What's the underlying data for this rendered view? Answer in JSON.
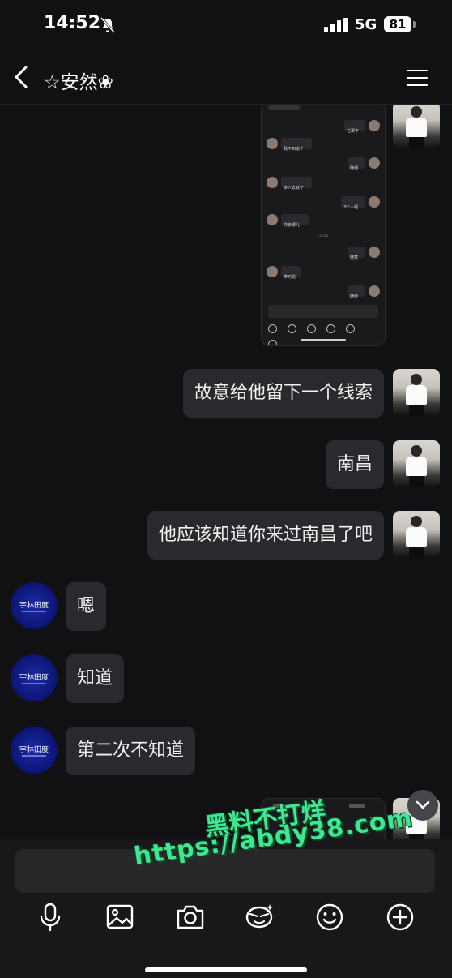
{
  "status": {
    "time": "14:52",
    "network": "5G",
    "battery": "81"
  },
  "header": {
    "title": "☆安然❀"
  },
  "messages": [
    {
      "side": "me",
      "text": "故意给他留下一个线索"
    },
    {
      "side": "me",
      "text": "南昌"
    },
    {
      "side": "me",
      "text": "他应该知道你来过南昌了吧"
    },
    {
      "side": "them",
      "text": "嗯"
    },
    {
      "side": "them",
      "text": "知道"
    },
    {
      "side": "them",
      "text": "第二次不知道"
    }
  ],
  "shared_screenshot": {
    "messages": [
      {
        "side": "me",
        "text": "在那不"
      },
      {
        "side": "them",
        "text": "我不知道个"
      },
      {
        "side": "me",
        "text": "随便"
      },
      {
        "side": "them",
        "text": "多人去就了"
      },
      {
        "side": "me",
        "text": "3个人呢"
      },
      {
        "side": "them",
        "text": "你去哪儿"
      },
      {
        "side": "me",
        "text": "随意"
      },
      {
        "side": "them",
        "text": "带时说"
      },
      {
        "side": "me",
        "text": "随便"
      }
    ],
    "time_marker": "15:32"
  },
  "them_avatar_label": "宇林田度",
  "watermark": {
    "line1": "黑料不打烊",
    "line2": "https://abdy38.com"
  },
  "icons": [
    "microphone-icon",
    "image-icon",
    "camera-icon",
    "sticker-icon",
    "emoji-icon",
    "plus-icon"
  ]
}
